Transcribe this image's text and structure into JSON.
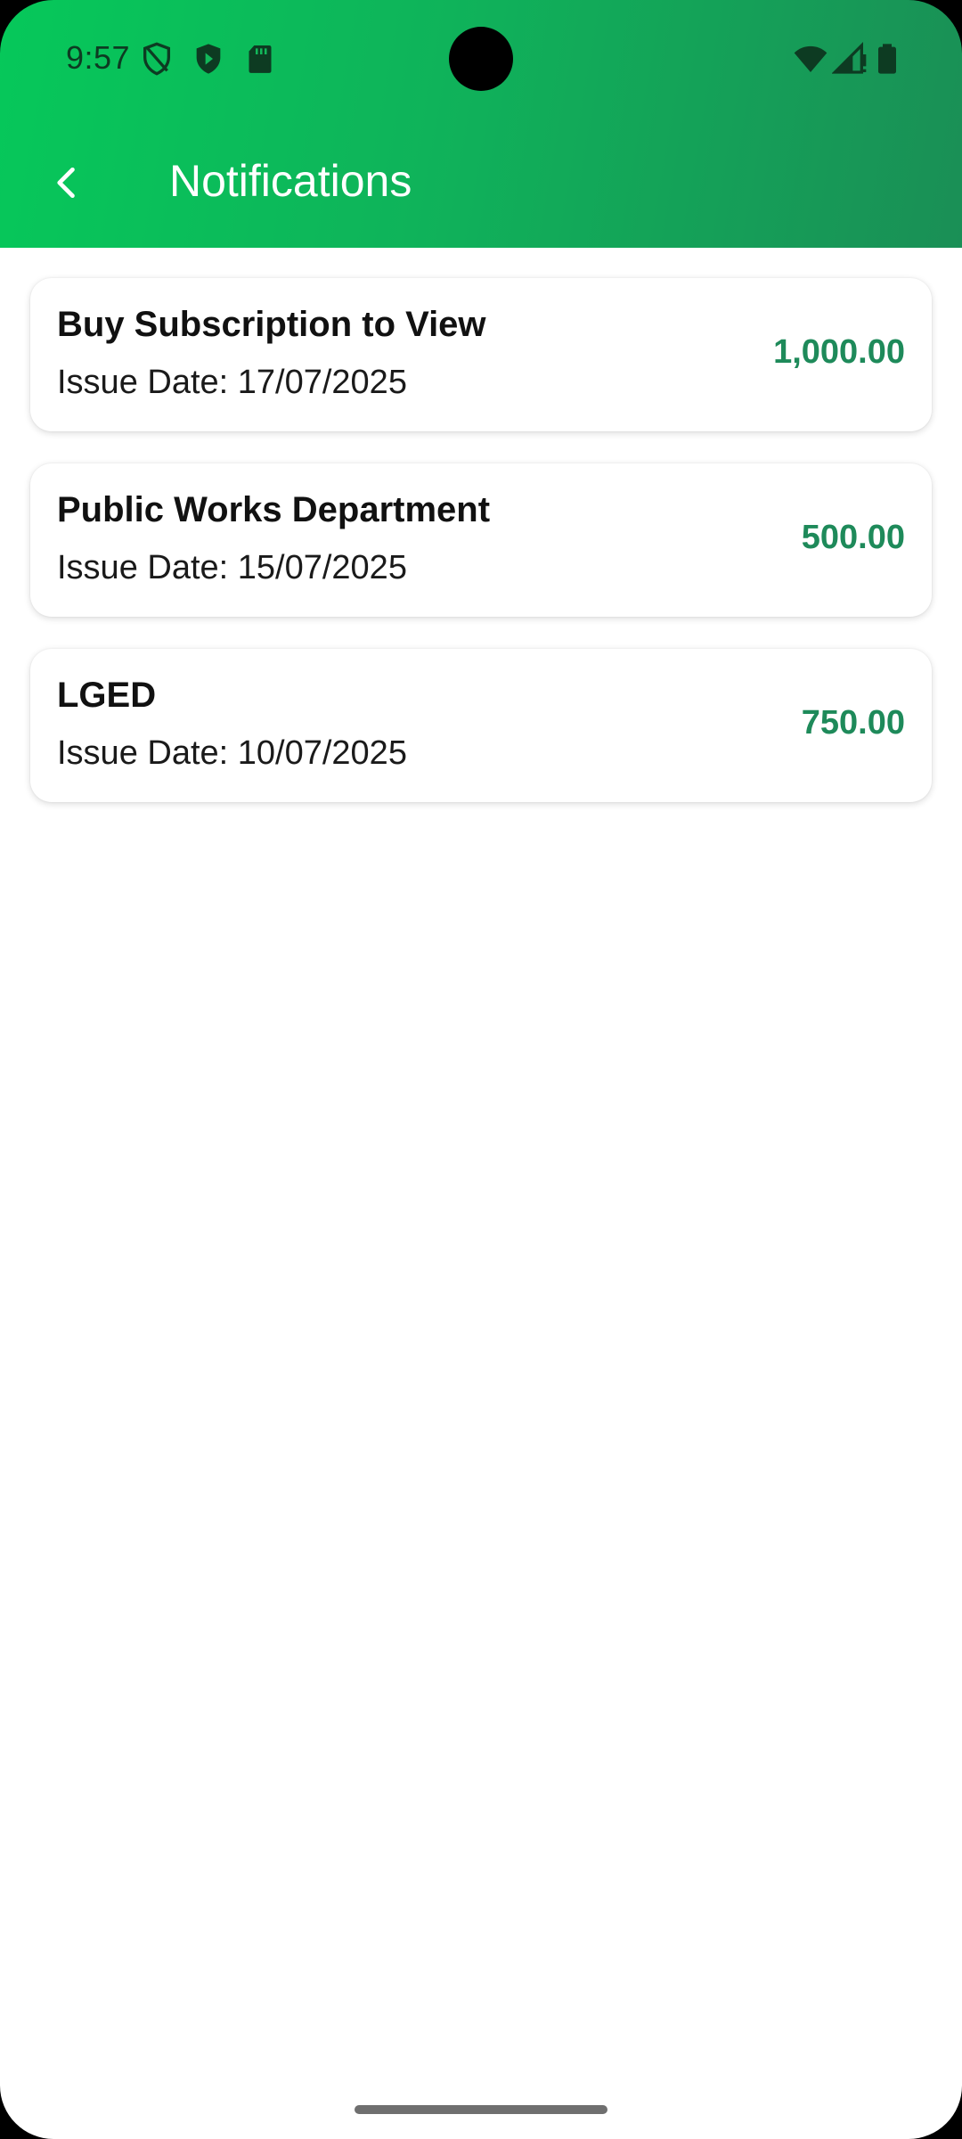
{
  "status_bar": {
    "time": "9:57",
    "left_icons": [
      "shield-outline-icon",
      "play-shield-icon",
      "sd-card-icon"
    ],
    "right_icons": [
      "wifi-icon",
      "cell-signal-icon",
      "battery-icon"
    ]
  },
  "app_bar": {
    "title": "Notifications",
    "back_icon": "chevron-left-icon"
  },
  "colors": {
    "header_start": "#06c85a",
    "header_end": "#1a8f56",
    "amount": "#1e8a5a"
  },
  "notifications": [
    {
      "title": "Buy Subscription to View",
      "date": "Issue Date: 17/07/2025",
      "amount": "1,000.00"
    },
    {
      "title": "Public Works Department",
      "date": "Issue Date: 15/07/2025",
      "amount": "500.00"
    },
    {
      "title": "LGED",
      "date": "Issue Date: 10/07/2025",
      "amount": "750.00"
    }
  ]
}
